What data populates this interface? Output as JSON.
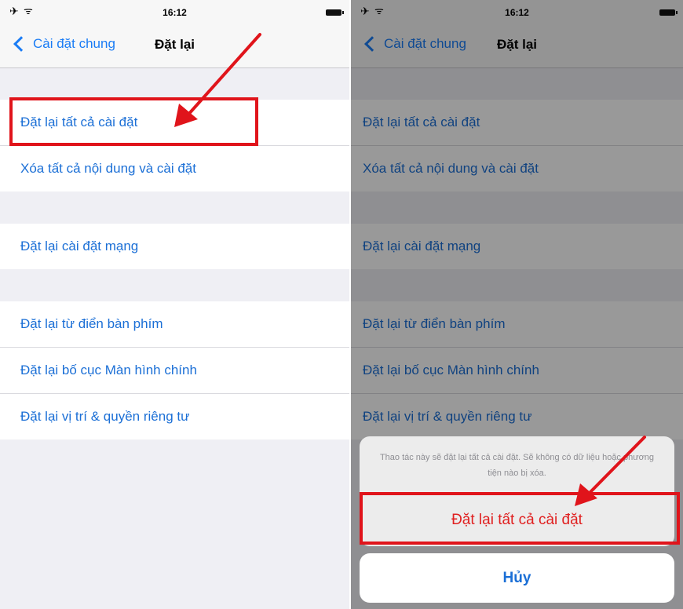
{
  "status_bar": {
    "time": "16:12"
  },
  "nav": {
    "back_label": "Cài đặt chung",
    "title": "Đặt lại"
  },
  "groups": [
    [
      "Đặt lại tất cả cài đặt",
      "Xóa tất cả nội dung và cài đặt"
    ],
    [
      "Đặt lại cài đặt mạng"
    ],
    [
      "Đặt lại từ điển bàn phím",
      "Đặt lại bố cục Màn hình chính",
      "Đặt lại vị trí & quyền riêng tư"
    ]
  ],
  "action_sheet": {
    "message": "Thao tác này sẽ đặt lại tất cả cài đặt. Sẽ không có dữ liệu hoặc phương tiện nào bị xóa.",
    "confirm_label": "Đặt lại tất cả cài đặt",
    "cancel_label": "Hủy"
  },
  "colors": {
    "ios_blue": "#1b6fd6",
    "destructive_red": "#e02020",
    "annotation_red": "#e0141b"
  }
}
